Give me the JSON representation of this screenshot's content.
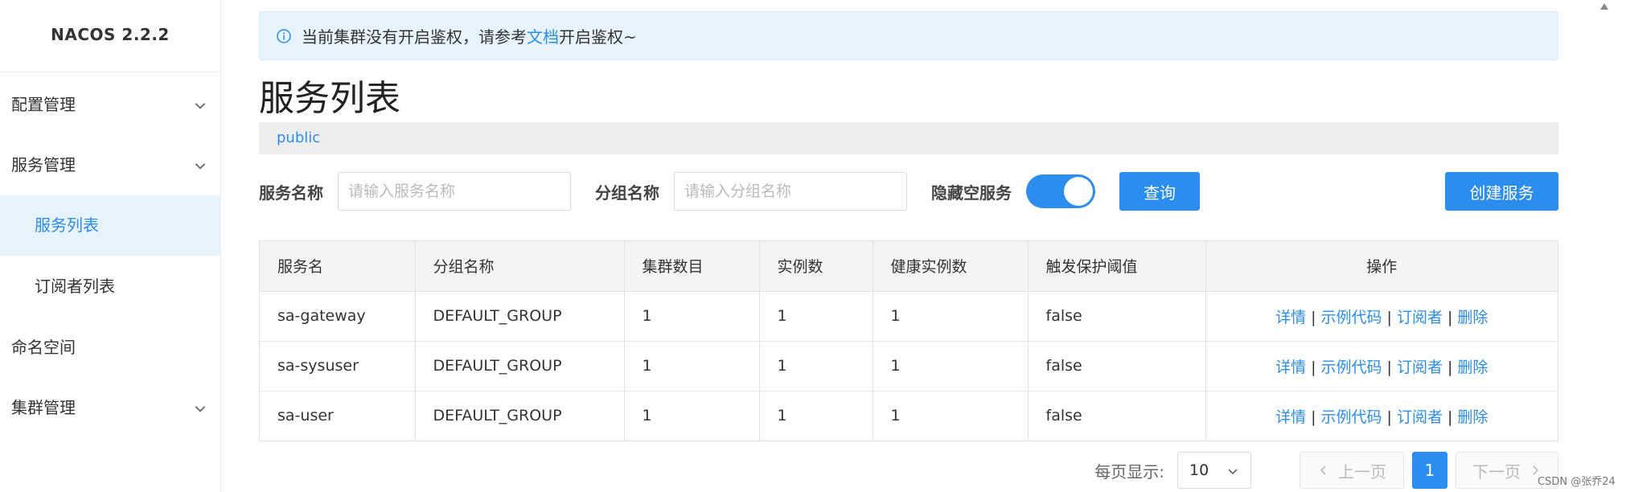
{
  "sidebar": {
    "brand": "NACOS 2.2.2",
    "items": [
      {
        "label": "配置管理"
      },
      {
        "label": "服务管理"
      },
      {
        "label": "服务列表"
      },
      {
        "label": "订阅者列表"
      },
      {
        "label": "命名空间"
      },
      {
        "label": "集群管理"
      }
    ]
  },
  "alert": {
    "text_before": "当前集群没有开启鉴权，请参考",
    "link": "文档",
    "text_after": "开启鉴权~"
  },
  "page": {
    "title": "服务列表",
    "namespace": "public"
  },
  "filter": {
    "service_label": "服务名称",
    "service_placeholder": "请输入服务名称",
    "group_label": "分组名称",
    "group_placeholder": "请输入分组名称",
    "hide_empty_label": "隐藏空服务",
    "hide_empty_on": true,
    "query_button": "查询",
    "create_button": "创建服务"
  },
  "table": {
    "headers": [
      "服务名",
      "分组名称",
      "集群数目",
      "实例数",
      "健康实例数",
      "触发保护阈值",
      "操作"
    ],
    "rows": [
      [
        "sa-gateway",
        "DEFAULT_GROUP",
        "1",
        "1",
        "1",
        "false"
      ],
      [
        "sa-sysuser",
        "DEFAULT_GROUP",
        "1",
        "1",
        "1",
        "false"
      ],
      [
        "sa-user",
        "DEFAULT_GROUP",
        "1",
        "1",
        "1",
        "false"
      ]
    ],
    "actions": [
      "详情",
      "示例代码",
      "订阅者",
      "删除"
    ],
    "action_separator": "|"
  },
  "pagination": {
    "per_page_label": "每页显示:",
    "per_page_value": "10",
    "prev": "上一页",
    "current_page": "1",
    "next": "下一页"
  },
  "watermark": "CSDN @张乔24",
  "colors": {
    "accent": "#2c8df0",
    "alert_bg": "#e7f3fd",
    "active_menu_bg": "#e8f4fd"
  }
}
